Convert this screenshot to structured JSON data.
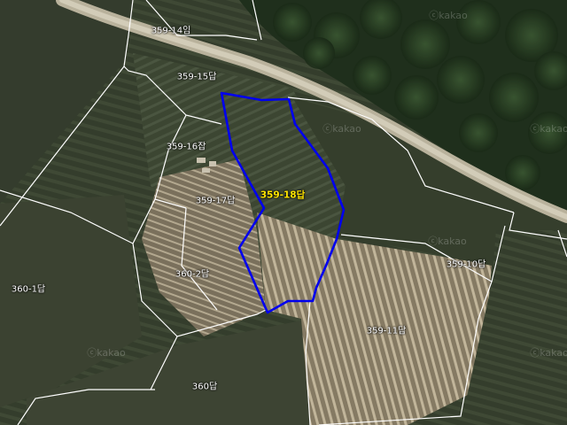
{
  "map": {
    "selected_parcel": "359-18답",
    "selection_color": "#0000ee",
    "boundary_color": "#ffffff",
    "watermark": "ⓒkakao",
    "parcels": [
      {
        "id": "p1",
        "label": "359-14임"
      },
      {
        "id": "p2",
        "label": "359-15답"
      },
      {
        "id": "p3",
        "label": "359-16잡"
      },
      {
        "id": "p4",
        "label": "359-17답"
      },
      {
        "id": "p5",
        "label": "359-18답"
      },
      {
        "id": "p6",
        "label": "360-2답"
      },
      {
        "id": "p7",
        "label": "360-1답"
      },
      {
        "id": "p8",
        "label": "359-10답"
      },
      {
        "id": "p9",
        "label": "359-11답"
      },
      {
        "id": "p10",
        "label": "360답"
      }
    ]
  }
}
